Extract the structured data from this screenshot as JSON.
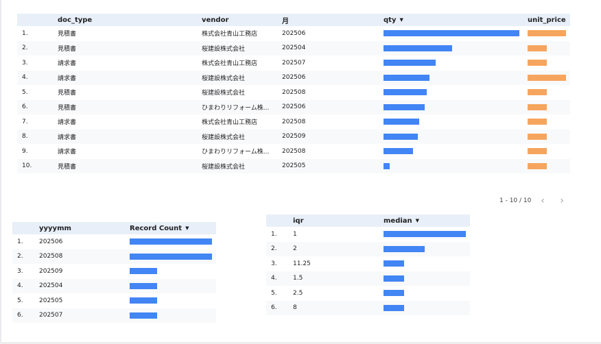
{
  "table1": {
    "headers": {
      "doc_type": "doc_type",
      "vendor": "vendor",
      "month": "月",
      "qty": "qty",
      "unit_price": "unit_price"
    },
    "sort_indicator": "▼",
    "rows": [
      {
        "num": "1.",
        "doc_type": "見積書",
        "vendor": "株式会社青山工務店",
        "month": "202506",
        "qty": 1.0,
        "unit_price": 1.0
      },
      {
        "num": "2.",
        "doc_type": "見積書",
        "vendor": "桜建設株式会社",
        "month": "202504",
        "qty": 0.505,
        "unit_price": 0.5
      },
      {
        "num": "3.",
        "doc_type": "請求書",
        "vendor": "株式会社青山工務店",
        "month": "202507",
        "qty": 0.385,
        "unit_price": 0.5
      },
      {
        "num": "4.",
        "doc_type": "請求書",
        "vendor": "桜建設株式会社",
        "month": "202506",
        "qty": 0.34,
        "unit_price": 1.0
      },
      {
        "num": "5.",
        "doc_type": "見積書",
        "vendor": "桜建設株式会社",
        "month": "202508",
        "qty": 0.32,
        "unit_price": 0.5
      },
      {
        "num": "6.",
        "doc_type": "見積書",
        "vendor": "ひまわりリフォーム株...",
        "month": "202506",
        "qty": 0.305,
        "unit_price": 0.5
      },
      {
        "num": "7.",
        "doc_type": "請求書",
        "vendor": "株式会社青山工務店",
        "month": "202508",
        "qty": 0.265,
        "unit_price": 0.5
      },
      {
        "num": "8.",
        "doc_type": "請求書",
        "vendor": "桜建設株式会社",
        "month": "202509",
        "qty": 0.255,
        "unit_price": 0.5
      },
      {
        "num": "9.",
        "doc_type": "請求書",
        "vendor": "ひまわりリフォーム株...",
        "month": "202508",
        "qty": 0.215,
        "unit_price": 0.5
      },
      {
        "num": "10.",
        "doc_type": "見積書",
        "vendor": "桜建設株式会社",
        "month": "202505",
        "qty": 0.045,
        "unit_price": 0.5
      }
    ]
  },
  "pagination": {
    "label": "1 - 10 / 10",
    "prev_icon": "chevron-left-icon",
    "next_icon": "chevron-right-icon"
  },
  "table2": {
    "headers": {
      "yyyymm": "yyyymm",
      "record_count": "Record Count"
    },
    "sort_indicator": "▼",
    "rows": [
      {
        "num": "1.",
        "yyyymm": "202506",
        "record_count": 1.0
      },
      {
        "num": "2.",
        "yyyymm": "202508",
        "record_count": 1.0
      },
      {
        "num": "3.",
        "yyyymm": "202509",
        "record_count": 0.33
      },
      {
        "num": "4.",
        "yyyymm": "202504",
        "record_count": 0.33
      },
      {
        "num": "5.",
        "yyyymm": "202505",
        "record_count": 0.33
      },
      {
        "num": "6.",
        "yyyymm": "202507",
        "record_count": 0.33
      }
    ]
  },
  "table3": {
    "headers": {
      "iqr": "iqr",
      "median": "median"
    },
    "sort_indicator": "▼",
    "rows": [
      {
        "num": "1.",
        "iqr": "1",
        "median": 1.0
      },
      {
        "num": "2.",
        "iqr": "2",
        "median": 0.5
      },
      {
        "num": "3.",
        "iqr": "11.25",
        "median": 0.25
      },
      {
        "num": "4.",
        "iqr": "1.5",
        "median": 0.25
      },
      {
        "num": "5.",
        "iqr": "2.5",
        "median": 0.25
      },
      {
        "num": "6.",
        "iqr": "8",
        "median": 0.25
      }
    ]
  },
  "colors": {
    "bar_blue": "#4285f4",
    "bar_orange": "#f6a55e",
    "header_bg": "#e9eff8",
    "alt_row_bg": "#f8f9fa"
  }
}
